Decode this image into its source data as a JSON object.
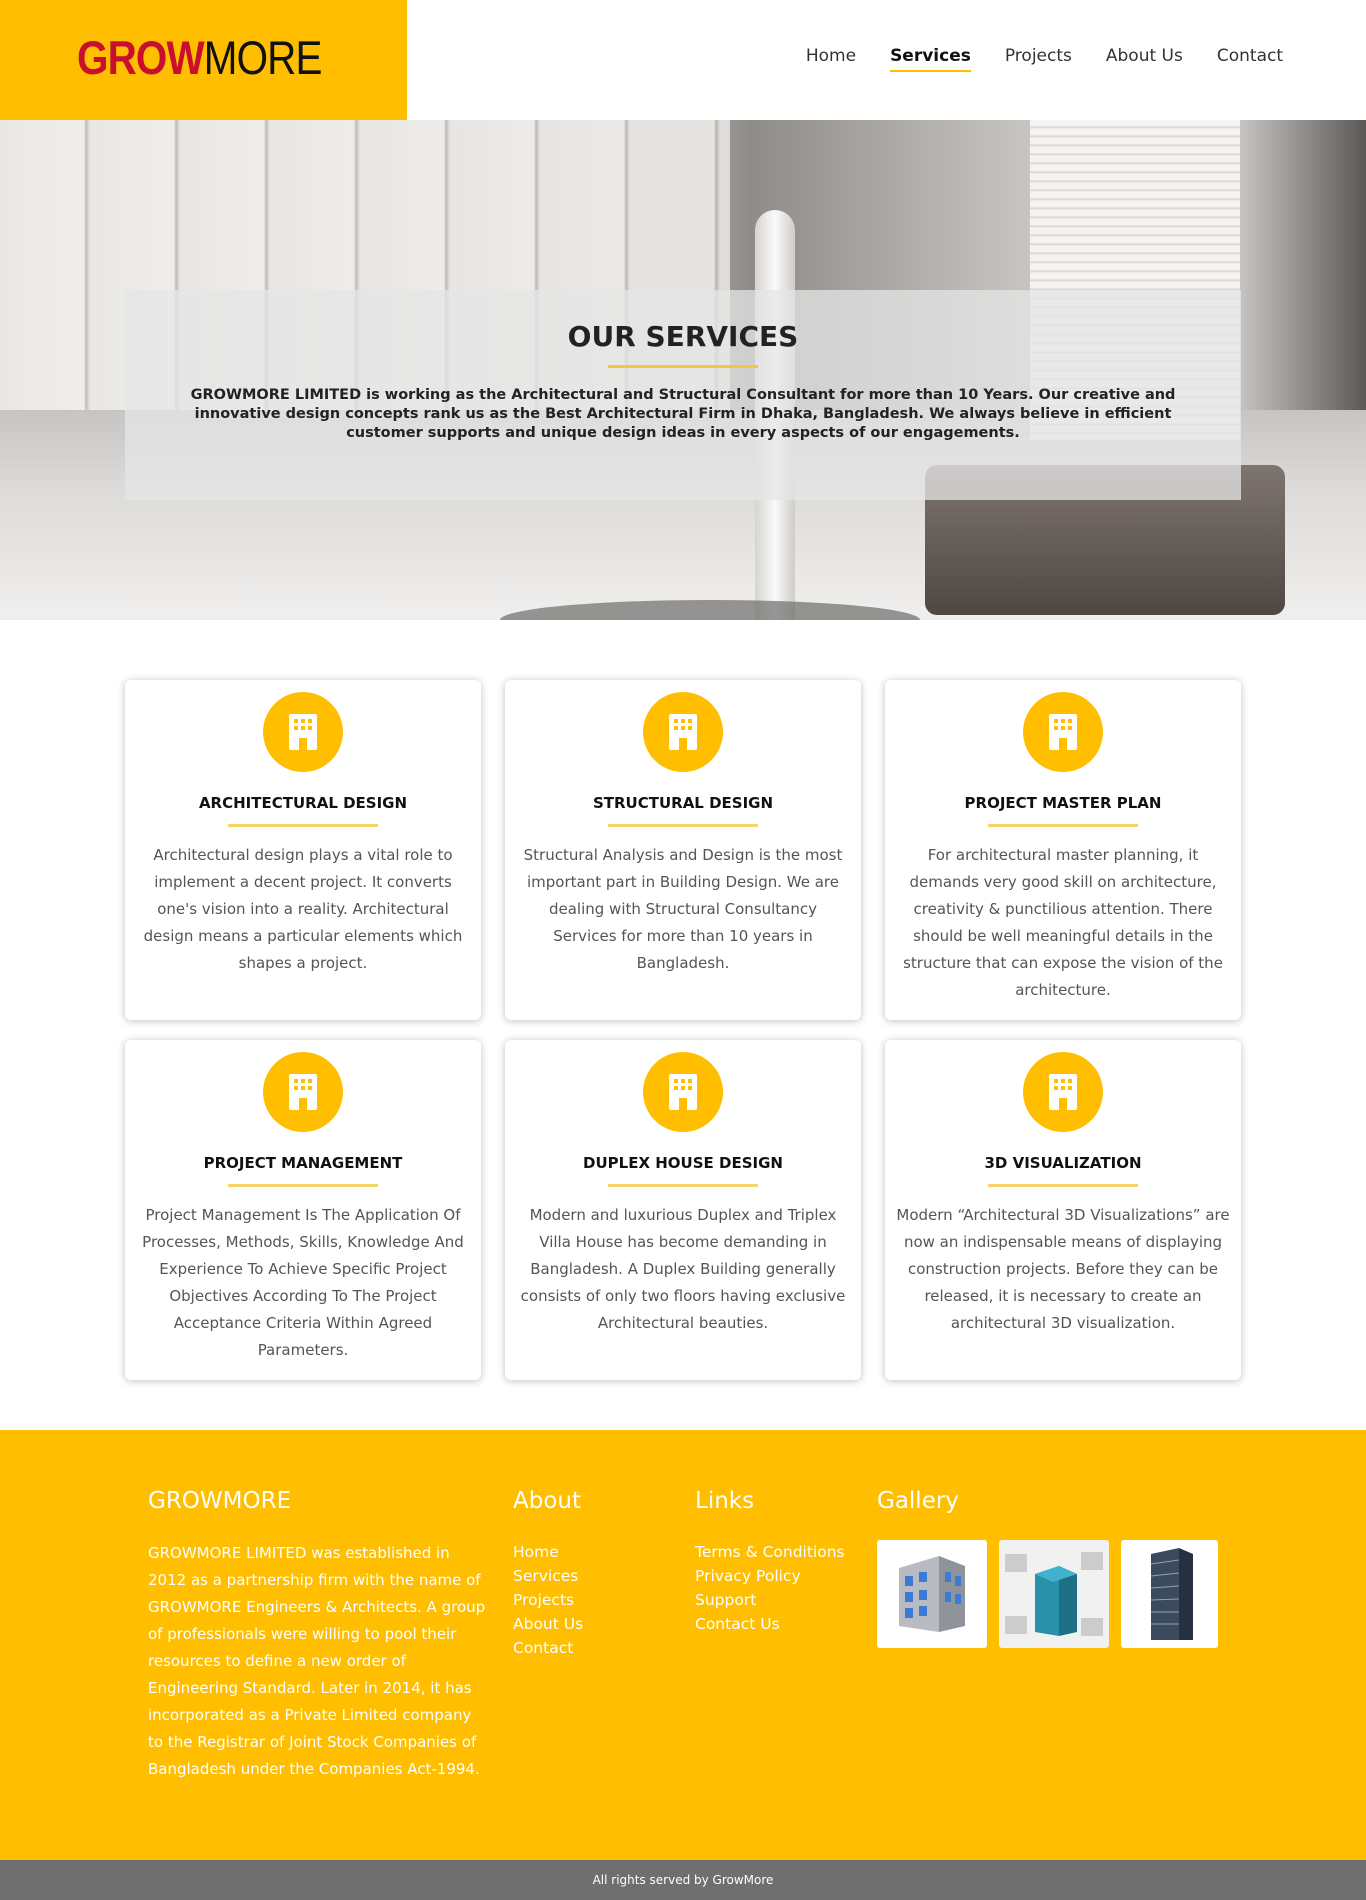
{
  "brand": {
    "part1": "GROW",
    "part2": "MORE"
  },
  "nav": {
    "items": [
      "Home",
      "Services",
      "Projects",
      "About Us",
      "Contact"
    ],
    "active": "Services"
  },
  "hero": {
    "title": "OUR SERVICES",
    "text": "GROWMORE LIMITED is working as the Architectural and Structural Consultant for more than 10 Years. Our creative and innovative design concepts rank us as the Best Architectural Firm in Dhaka, Bangladesh. We always believe in efficient customer supports and unique design ideas in every aspects of our engagements."
  },
  "services": [
    {
      "title": "ARCHITECTURAL DESIGN",
      "text": "Architectural design plays a vital role to implement a decent project. It converts one's vision into a reality. Architectural design means a particular elements which shapes a project."
    },
    {
      "title": "STRUCTURAL DESIGN",
      "text": "Structural Analysis and Design is the most important part in Building Design. We are dealing with Structural Consultancy Services for more than 10 years in Bangladesh."
    },
    {
      "title": "PROJECT MASTER PLAN",
      "text": "For architectural master planning, it demands very good skill on architecture, creativity & punctilious attention. There should be well meaningful details in the structure that can expose the vision of the architecture."
    },
    {
      "title": "PROJECT MANAGEMENT",
      "text": "Project Management Is The Application Of Processes, Methods, Skills, Knowledge And Experience To Achieve Specific Project Objectives According To The Project Acceptance Criteria Within Agreed Parameters."
    },
    {
      "title": "DUPLEX HOUSE DESIGN",
      "text": "Modern and luxurious Duplex and Triplex Villa House has become demanding in Bangladesh. A Duplex Building generally consists of only two floors having exclusive Architectural beauties."
    },
    {
      "title": "3D VISUALIZATION",
      "text": "Modern “Architectural 3D Visualizations” are now an indispensable means of displaying construction projects. Before they can be released, it is necessary to create an architectural 3D visualization."
    }
  ],
  "footer": {
    "about_head": "GROWMORE",
    "about_text": "GROWMORE LIMITED was established in 2012 as a partnership firm with the name of GROWMORE Engineers & Architects. A group of professionals were willing to pool their resources to define a new order of Engineering Standard. Later in 2014, it has incorporated as a Private Limited company to the Registrar of Joint Stock Companies of Bangladesh under the Companies Act-1994.",
    "about_links_head": "About",
    "about_links": [
      "Home",
      "Services",
      "Projects",
      "About Us",
      "Contact"
    ],
    "links_head": "Links",
    "links": [
      "Terms & Conditions",
      "Privacy Policy",
      "Support",
      "Contact Us"
    ],
    "gallery_head": "Gallery",
    "copyright": "All rights served by GrowMore"
  },
  "colors": {
    "accent": "#ffbf00",
    "logo_red": "#c8102e"
  }
}
